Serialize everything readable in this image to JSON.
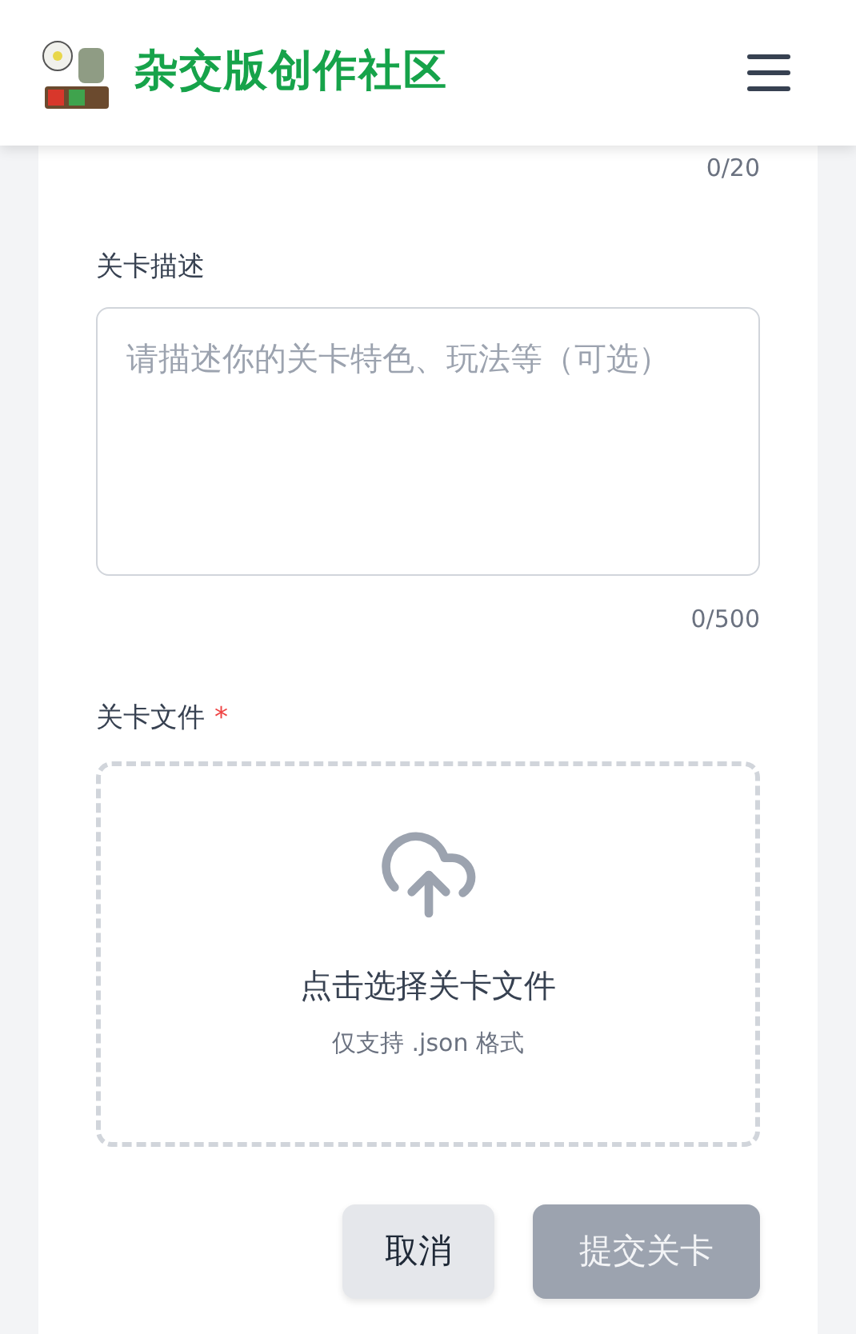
{
  "header": {
    "title": "杂交版创作社区"
  },
  "name_counter": "0/20",
  "description": {
    "label": "关卡描述",
    "placeholder": "请描述你的关卡特色、玩法等（可选）",
    "counter": "0/500"
  },
  "file": {
    "label": "关卡文件",
    "required_mark": "*",
    "prompt": "点击选择关卡文件",
    "hint": "仅支持 .json 格式"
  },
  "buttons": [
    {
      "kind": "cancel",
      "label": "取消",
      "disabled": false
    },
    {
      "kind": "submit",
      "label": "提交关卡",
      "disabled": true
    }
  ]
}
